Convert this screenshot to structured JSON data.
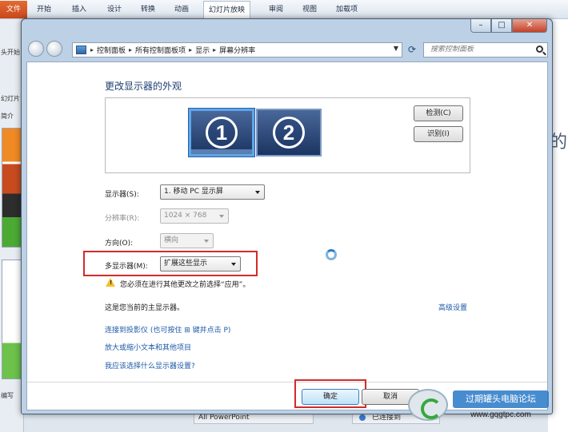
{
  "ppt": {
    "file_tab": "文件",
    "tabs": [
      "开始",
      "插入",
      "设计",
      "转换",
      "动画",
      "幻灯片放映",
      "审阅",
      "视图",
      "加载项"
    ],
    "left_texts": [
      "头开始",
      "幻灯片",
      "简介"
    ],
    "bottom_left": "编写",
    "right_letter": "的",
    "bottom_text": "All PowerPoint",
    "bottom_status": "已连接到"
  },
  "window": {
    "controls": {
      "min": "–",
      "max": "□",
      "close": "✕"
    },
    "breadcrumbs": [
      "控制面板",
      "所有控制面板项",
      "显示",
      "屏幕分辨率"
    ],
    "search_placeholder": "搜索控制面板"
  },
  "display": {
    "title": "更改显示器的外观",
    "monitors": [
      {
        "number": "1",
        "selected": true
      },
      {
        "number": "2",
        "selected": false
      }
    ],
    "detect_button": "检测(C)",
    "identify_button": "识别(I)",
    "fields": {
      "display": {
        "label": "显示器(S):",
        "value": "1. 移动 PC 显示屏"
      },
      "resolution": {
        "label": "分辨率(R):",
        "value": "1024 × 768"
      },
      "orientation": {
        "label": "方向(O):",
        "value": "横向"
      },
      "multiple": {
        "label": "多显示器(M):",
        "value": "扩展这些显示"
      }
    },
    "warning": "您必须在进行其他更改之前选择“应用”。",
    "primary_note": "这是您当前的主显示器。",
    "advanced_link": "高级设置",
    "links": [
      "连接到投影仪 (也可按住 ⊞ 键并点击 P)",
      "放大或缩小文本和其他项目",
      "我应该选择什么显示器设置?"
    ],
    "ok_button": "确定",
    "cancel_button": "取消"
  },
  "watermark": {
    "title": "过期罐头电脑论坛",
    "url": "www.gqgtpc.com"
  },
  "colors": {
    "highlight": "#d42a2a",
    "link": "#1d5aa8",
    "title": "#1e3f73"
  }
}
